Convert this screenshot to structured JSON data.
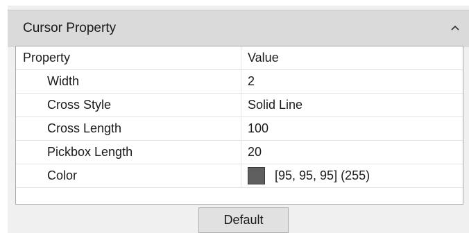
{
  "panel": {
    "title": "Cursor Property",
    "collapse_icon": "chevron-up-icon"
  },
  "grid": {
    "columns": [
      "Property",
      "Value"
    ],
    "rows": [
      {
        "name": "Width",
        "value": "2"
      },
      {
        "name": "Cross Style",
        "value": "Solid Line"
      },
      {
        "name": "Cross Length",
        "value": "100"
      },
      {
        "name": "Pickbox Length",
        "value": "20"
      },
      {
        "name": "Color",
        "value": "[95, 95, 95] (255)",
        "swatch_color": "#5f5f5f"
      }
    ]
  },
  "footer": {
    "default_label": "Default"
  }
}
